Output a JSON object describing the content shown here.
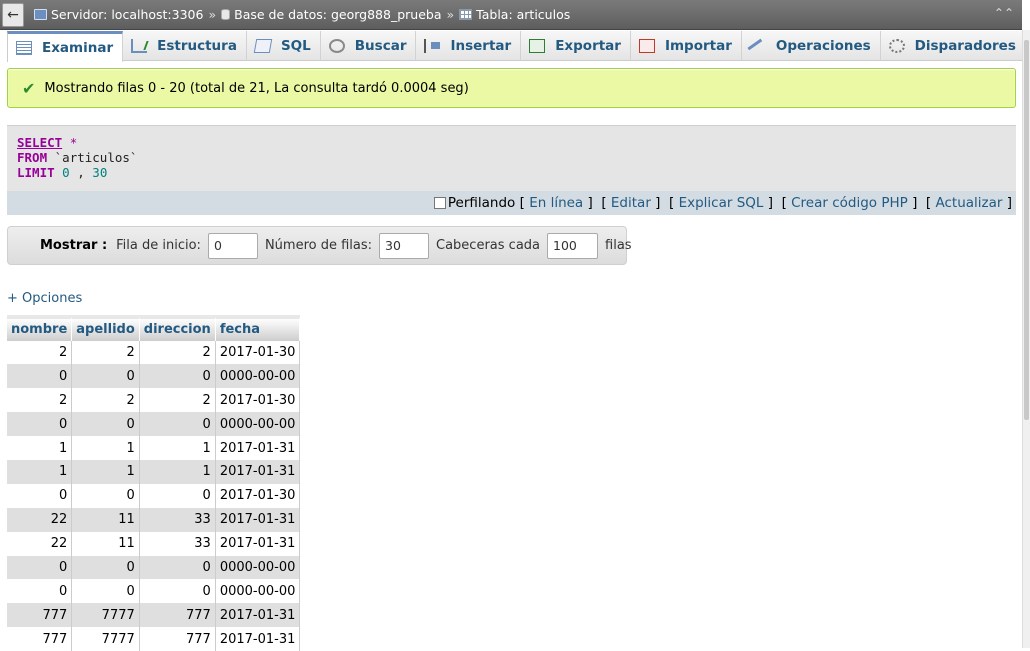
{
  "breadcrumb": {
    "back_label": "←",
    "server": "Servidor: localhost:3306",
    "database": "Base de datos: georg888_prueba",
    "table": "Tabla: articulos",
    "separator": "»",
    "collapse_label": "⌃⌃"
  },
  "tabs": [
    {
      "label": "Examinar",
      "icon": "browse-icon",
      "active": true
    },
    {
      "label": "Estructura",
      "icon": "structure-icon"
    },
    {
      "label": "SQL",
      "icon": "sql-icon"
    },
    {
      "label": "Buscar",
      "icon": "search-icon"
    },
    {
      "label": "Insertar",
      "icon": "insert-icon"
    },
    {
      "label": "Exportar",
      "icon": "export-icon"
    },
    {
      "label": "Importar",
      "icon": "import-icon"
    },
    {
      "label": "Operaciones",
      "icon": "operations-icon"
    },
    {
      "label": "Disparadores",
      "icon": "triggers-icon"
    }
  ],
  "success": {
    "message": "Mostrando filas 0 - 20 (total de 21, La consulta tardó 0.0004 seg)"
  },
  "sql": {
    "select_kw": "SELECT",
    "star": "*",
    "from_kw": "FROM",
    "table": "`articulos`",
    "limit_kw": "LIMIT",
    "limit_offset": "0",
    "limit_comma": ",",
    "limit_count": "30"
  },
  "sql_actions": {
    "profiling": "Perfilando",
    "inline": "En línea",
    "edit": "Editar",
    "explain": "Explicar SQL",
    "php": "Crear código PHP",
    "refresh": "Actualizar"
  },
  "nav": {
    "show_label": "Mostrar :",
    "start_label": "Fila de inicio:",
    "start_value": "0",
    "rows_label": "Número de filas:",
    "rows_value": "30",
    "headers_label": "Cabeceras cada",
    "headers_value": "100",
    "rows_suffix": "filas"
  },
  "options_link": "+ Opciones",
  "table": {
    "columns": [
      "nombre",
      "apellido",
      "direccion",
      "fecha"
    ],
    "rows": [
      [
        "2",
        "2",
        "2",
        "2017-01-30"
      ],
      [
        "0",
        "0",
        "0",
        "0000-00-00"
      ],
      [
        "2",
        "2",
        "2",
        "2017-01-30"
      ],
      [
        "0",
        "0",
        "0",
        "0000-00-00"
      ],
      [
        "1",
        "1",
        "1",
        "2017-01-31"
      ],
      [
        "1",
        "1",
        "1",
        "2017-01-31"
      ],
      [
        "0",
        "0",
        "0",
        "2017-01-30"
      ],
      [
        "22",
        "11",
        "33",
        "2017-01-31"
      ],
      [
        "22",
        "11",
        "33",
        "2017-01-31"
      ],
      [
        "0",
        "0",
        "0",
        "0000-00-00"
      ],
      [
        "0",
        "0",
        "0",
        "0000-00-00"
      ],
      [
        "777",
        "7777",
        "777",
        "2017-01-31"
      ],
      [
        "777",
        "7777",
        "777",
        "2017-01-31"
      ]
    ]
  }
}
